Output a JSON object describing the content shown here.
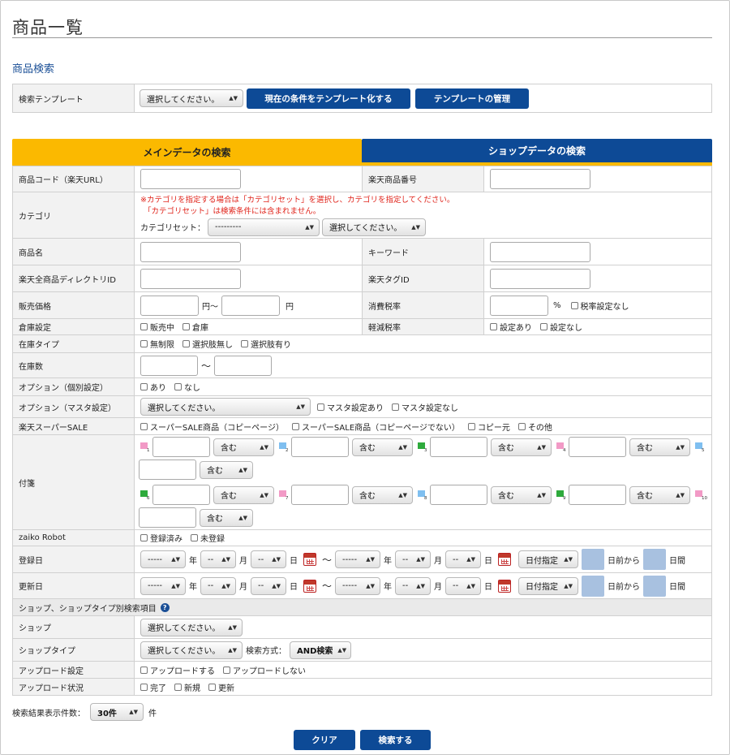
{
  "page": {
    "title": "商品一覧",
    "section": "商品検索"
  },
  "template": {
    "label": "検索テンプレート",
    "select": "選択してください。",
    "btn_save": "現在の条件をテンプレート化する",
    "btn_manage": "テンプレートの管理"
  },
  "tabs": {
    "main": "メインデータの検索",
    "shop": "ショップデータの検索"
  },
  "f": {
    "code": "商品コード（楽天URL）",
    "rakuten_no": "楽天商品番号",
    "category": "カテゴリ",
    "cat_note1": "※カテゴリを指定する場合は「カテゴリセット」を選択し、カテゴリを指定してください。",
    "cat_note2": "「カテゴリセット」は検索条件には含まれません。",
    "cat_set": "カテゴリセット：",
    "cat_set_val": "---------",
    "cat_val": "選択してください。",
    "name": "商品名",
    "keyword": "キーワード",
    "dir_id": "楽天全商品ディレクトリID",
    "tag_id": "楽天タグID",
    "price": "販売価格",
    "yen1": "円〜",
    "yen2": "円",
    "tax": "消費税率",
    "pct": "%",
    "tax_none": "税率設定なし",
    "warehouse": "倉庫設定",
    "on_sale": "販売中",
    "in_wh": "倉庫",
    "reduced": "軽減税率",
    "red_yes": "設定あり",
    "red_no": "設定なし",
    "stock_type": "在庫タイプ",
    "st1": "無制限",
    "st2": "選択肢無し",
    "st3": "選択肢有り",
    "stock_qty": "在庫数",
    "tilde": "〜",
    "opt_ind": "オプション（個別設定）",
    "yes": "あり",
    "no": "なし",
    "opt_master": "オプション（マスタ設定）",
    "opt_sel": "選択してください。",
    "m_yes": "マスタ設定あり",
    "m_no": "マスタ設定なし",
    "super_sale": "楽天スーパーSALE",
    "ss1": "スーパーSALE商品（コピーページ）",
    "ss2": "スーパーSALE商品（コピーページでない）",
    "ss3": "コピー元",
    "ss4": "その他",
    "tag": "付箋",
    "contain": "含む",
    "zaiko": "zaiko Robot",
    "z1": "登録済み",
    "z2": "未登録",
    "reg_date": "登録日",
    "upd_date": "更新日",
    "year": "年",
    "month": "月",
    "day": "日",
    "range": "〜",
    "ymd_y": "-----",
    "ymd_md": "--",
    "date_spec": "日付指定",
    "before": "日前から",
    "between": "日間",
    "shop_hdr": "ショップ、ショップタイプ別検索項目",
    "shop": "ショップ",
    "shop_sel": "選択してください。",
    "shop_type": "ショップタイプ",
    "shop_type_sel": "選択してください。",
    "mode_lbl": "検索方式：",
    "mode_val": "AND検索",
    "upload": "アップロード設定",
    "up1": "アップロードする",
    "up2": "アップロードしない",
    "upstatus": "アップロード状況",
    "us1": "完了",
    "us2": "新規",
    "us3": "更新"
  },
  "flag_nums": [
    "1",
    "2",
    "3",
    "4",
    "5",
    "6",
    "7",
    "8",
    "9",
    "10"
  ],
  "flag_colors": [
    "#f29ac6",
    "#7fbff0",
    "#2eaa3c",
    "#f29ac6",
    "#7fbff0",
    "#2eaa3c",
    "#f29ac6",
    "#7fbff0",
    "#2eaa3c",
    "#f29ac6"
  ],
  "footer": {
    "count_lbl": "検索結果表示件数：",
    "count_val": "30件",
    "count_unit": "件",
    "clear": "クリア",
    "search": "検索する"
  }
}
